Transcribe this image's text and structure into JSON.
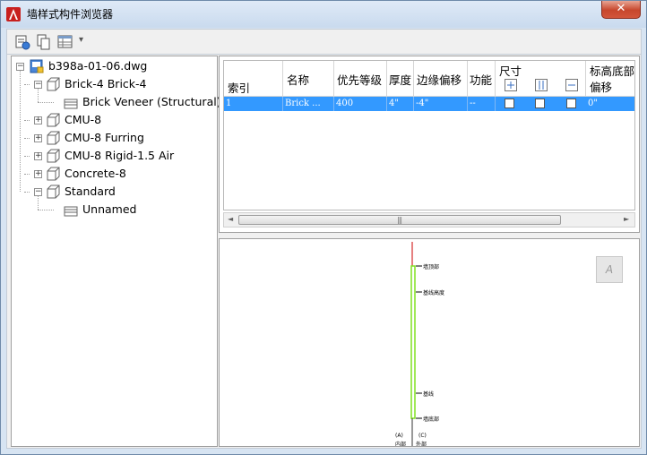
{
  "window": {
    "title": "墙样式构件浏览器",
    "close_glyph": "✕"
  },
  "toolbar": {
    "dropdown_glyph": "▾"
  },
  "tree": {
    "root": {
      "label": "b398a-01-06.dwg",
      "expander": "−"
    },
    "items": [
      {
        "label": "Brick-4 Brick-4",
        "expander": "−"
      },
      {
        "label": "Brick Veneer (Structural)"
      },
      {
        "label": "CMU-8",
        "expander": "+"
      },
      {
        "label": "CMU-8 Furring",
        "expander": "+"
      },
      {
        "label": "CMU-8 Rigid-1.5 Air",
        "expander": "+"
      },
      {
        "label": "Concrete-8",
        "expander": "+"
      },
      {
        "label": "Standard",
        "expander": "−"
      },
      {
        "label": "Unnamed"
      }
    ]
  },
  "grid": {
    "columns": {
      "index": "索引",
      "name": "名称",
      "priority": "优先等级",
      "thickness": "厚度",
      "edge_offset": "边缘偏移",
      "function": "功能",
      "dimension": "尺寸",
      "bottom_elev_1": "标高底部",
      "bottom_elev_2": "偏移"
    },
    "row": {
      "index": "1",
      "name": "Brick ...",
      "priority": "400",
      "thickness": "4\"",
      "edge_offset": "-4\"",
      "function": "--",
      "bottom_elev": "0\""
    }
  },
  "scrollbar": {
    "left": "◄",
    "right": "►",
    "grip": "|||"
  },
  "preview": {
    "labels": {
      "top": "墙顶部",
      "base_height": "基线高度",
      "baseline": "基线",
      "bottom": "墙底部",
      "left_marker": "(A)",
      "right_marker": "(C)",
      "inside": "内部",
      "outside": "外部"
    },
    "colors": {
      "wall": "#80e020",
      "axis": "#cc0000"
    },
    "button_glyph": "A"
  }
}
